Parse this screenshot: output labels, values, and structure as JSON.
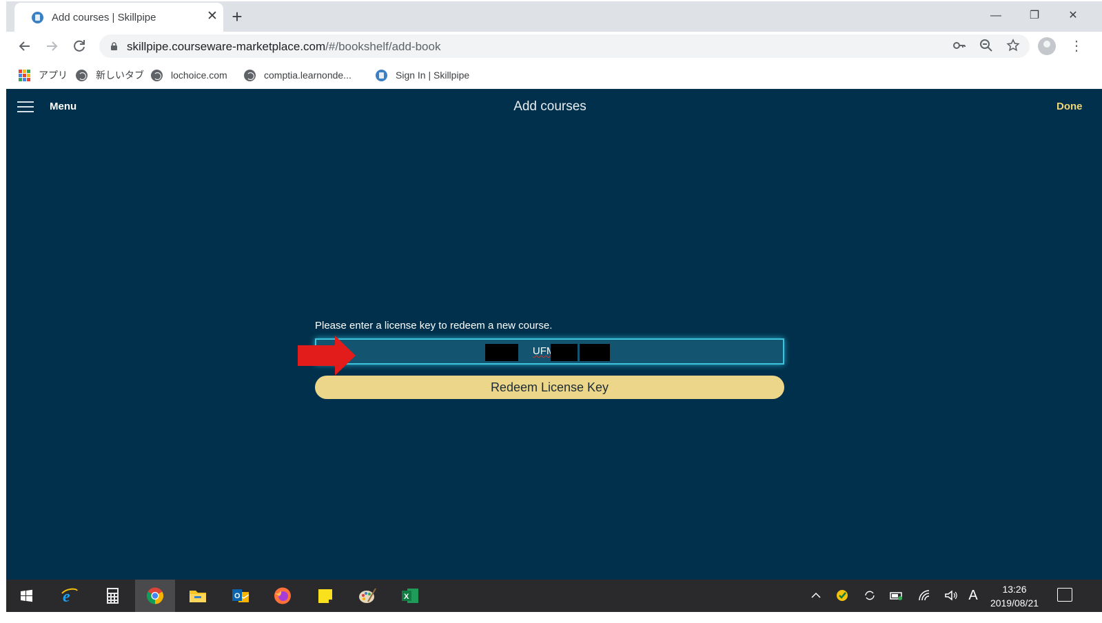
{
  "browser": {
    "tab_title": "Add courses | Skillpipe",
    "tab_close": "✕",
    "new_tab": "+",
    "url_host": "skillpipe.courseware-marketplace.com",
    "url_path": "/#/bookshelf/add-book",
    "window_controls": [
      "—",
      "❐",
      "✕"
    ]
  },
  "bookmarks": [
    {
      "label": "アプリ",
      "icon": "apps-grid-icon"
    },
    {
      "label": "新しいタブ",
      "icon": "globe-icon"
    },
    {
      "label": "lochoice.com",
      "icon": "globe-icon"
    },
    {
      "label": "comptia.learnonde...",
      "icon": "globe-icon"
    },
    {
      "label": "Sign In | Skillpipe",
      "icon": "skillpipe-icon"
    }
  ],
  "app": {
    "menu_label": "Menu",
    "title": "Add courses",
    "done_label": "Done",
    "prompt": "Please enter a license key to redeem a new course.",
    "license_key_visible": "UFMG-",
    "redeem_label": "Redeem License Key"
  },
  "taskbar": {
    "time": "13:26",
    "date": "2019/08/21",
    "ime": "A"
  },
  "colors": {
    "app_bg": "#00304b",
    "accent_button": "#ecd689",
    "input_border": "#3fc3dc",
    "arrow": "#e21b1b"
  }
}
